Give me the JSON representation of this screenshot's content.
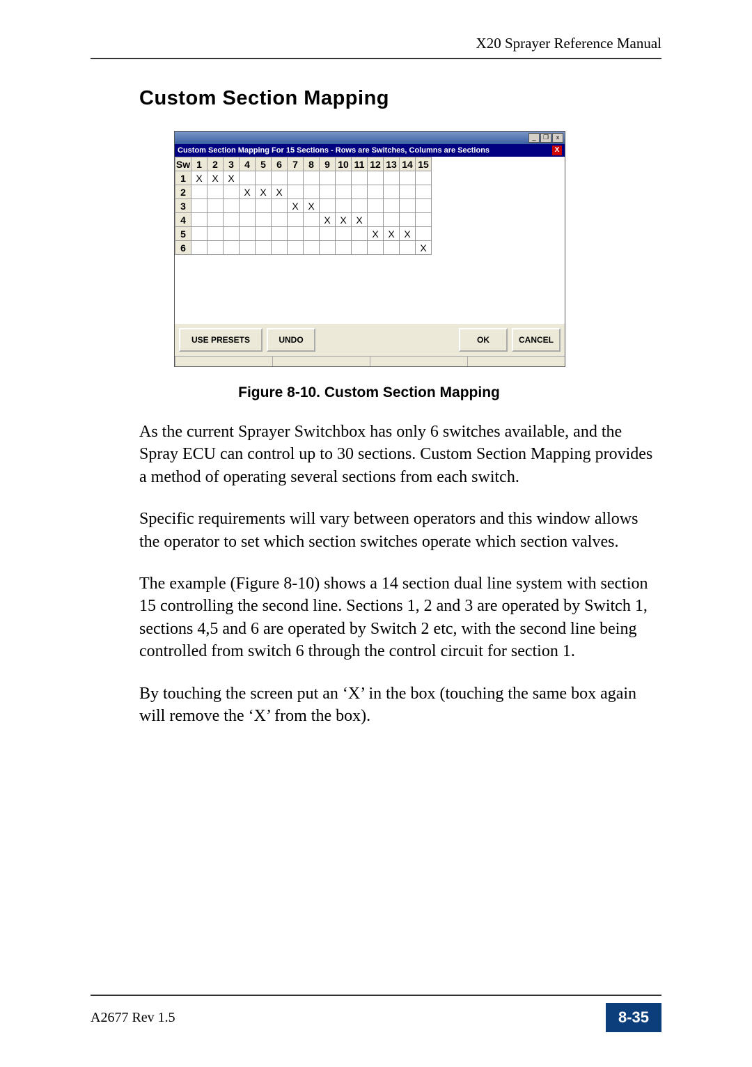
{
  "header": {
    "doc_title": "X20 Sprayer Reference Manual"
  },
  "heading": "Custom Section Mapping",
  "dialog": {
    "bluebar_text": "Custom Section Mapping For 15 Sections - Rows are Switches, Columns are Sections",
    "corner_label": "Sw",
    "col_headers": [
      "1",
      "2",
      "3",
      "4",
      "5",
      "6",
      "7",
      "8",
      "9",
      "10",
      "11",
      "12",
      "13",
      "14",
      "15"
    ],
    "row_headers": [
      "1",
      "2",
      "3",
      "4",
      "5",
      "6"
    ],
    "cells": [
      [
        "X",
        "X",
        "X",
        "",
        "",
        "",
        "",
        "",
        "",
        "",
        "",
        "",
        "",
        "",
        ""
      ],
      [
        "",
        "",
        "",
        "X",
        "X",
        "X",
        "",
        "",
        "",
        "",
        "",
        "",
        "",
        "",
        ""
      ],
      [
        "",
        "",
        "",
        "",
        "",
        "",
        "X",
        "X",
        "",
        "",
        "",
        "",
        "",
        "",
        ""
      ],
      [
        "",
        "",
        "",
        "",
        "",
        "",
        "",
        "",
        "X",
        "X",
        "X",
        "",
        "",
        "",
        ""
      ],
      [
        "",
        "",
        "",
        "",
        "",
        "",
        "",
        "",
        "",
        "",
        "",
        "X",
        "X",
        "X",
        ""
      ],
      [
        "",
        "",
        "",
        "",
        "",
        "",
        "",
        "",
        "",
        "",
        "",
        "",
        "",
        "",
        "X"
      ]
    ],
    "buttons": {
      "use_presets": "USE PRESETS",
      "undo": "UNDO",
      "ok": "OK",
      "cancel": "CANCEL"
    }
  },
  "figure_caption": "Figure 8-10. Custom Section Mapping",
  "paragraphs": {
    "p1": "As the current Sprayer Switchbox has only 6 switches available, and the Spray ECU can control up to 30 sections. Custom Section Mapping provides a method of operating several sections from each switch.",
    "p2": "Specific requirements will vary between operators and this window allows the operator to set which section switches operate which section valves.",
    "p3": "The example (Figure 8-10) shows a 14 section dual line system with section 15 controlling the second line. Sections 1, 2 and 3 are operated by Switch 1, sections 4,5 and 6 are operated by Switch 2 etc, with the second line being controlled from switch 6 through the control circuit for section 1.",
    "p4": "By touching the screen put an ‘X’ in the box (touching the same box again will remove the ‘X’ from the box)."
  },
  "footer": {
    "left": "A2677 Rev 1.5",
    "right": "8-35"
  }
}
